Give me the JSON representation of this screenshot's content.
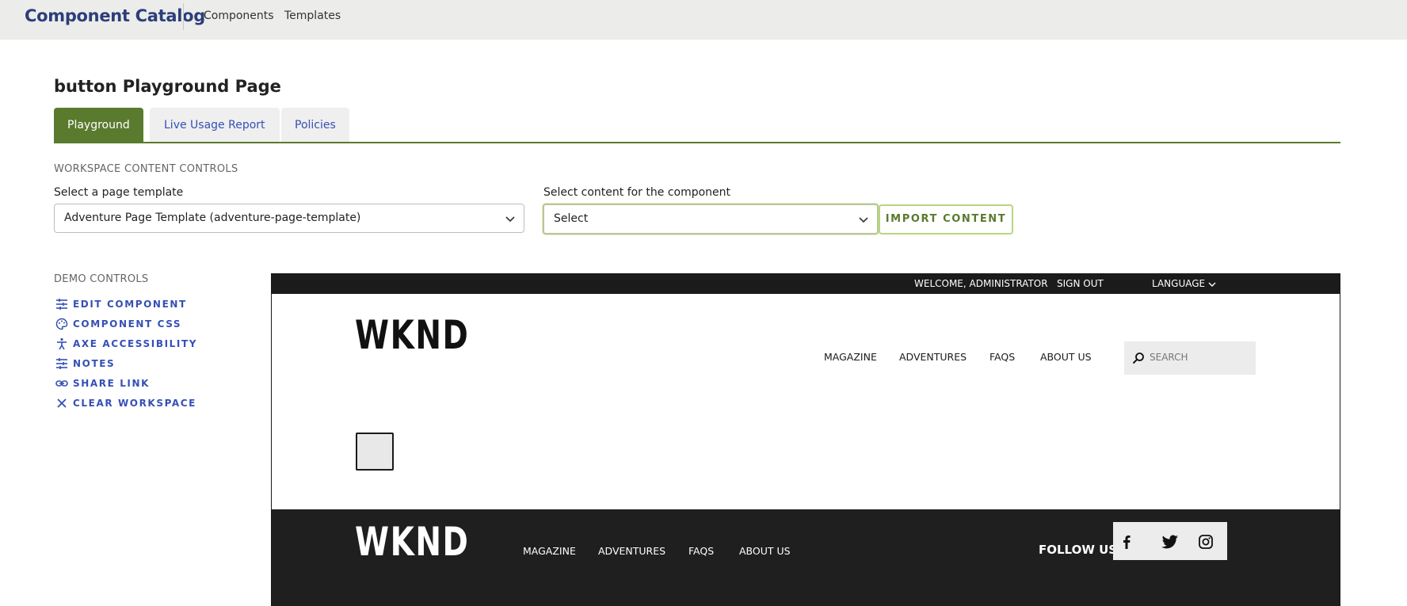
{
  "header": {
    "brand": "Component Catalog",
    "nav": [
      "Components",
      "Templates"
    ]
  },
  "page": {
    "title": "button Playground Page",
    "tabs": [
      {
        "label": "Playground",
        "active": true
      },
      {
        "label": "Live Usage Report",
        "active": false
      },
      {
        "label": "Policies",
        "active": false
      }
    ]
  },
  "workspace": {
    "section_label": "WORKSPACE CONTENT CONTROLS",
    "template_label": "Select a page template",
    "template_value": "Adventure Page Template (adventure-page-template)",
    "content_label": "Select content for the component",
    "content_value": "Select",
    "import_label": "IMPORT CONTENT"
  },
  "demo_controls": {
    "section_label": "DEMO CONTROLS",
    "items": [
      {
        "label": "EDIT COMPONENT",
        "icon": "sliders-icon"
      },
      {
        "label": "COMPONENT CSS",
        "icon": "palette-icon"
      },
      {
        "label": "AXE ACCESSIBILITY",
        "icon": "accessibility-icon"
      },
      {
        "label": "NOTES",
        "icon": "notes-icon"
      },
      {
        "label": "SHARE LINK",
        "icon": "link-icon"
      },
      {
        "label": "CLEAR WORKSPACE",
        "icon": "close-icon"
      }
    ]
  },
  "preview": {
    "topbar": {
      "welcome": "WELCOME, ADMINISTRATOR",
      "sign_out": "SIGN OUT",
      "language": "LANGUAGE"
    },
    "logo": "WKND",
    "nav": [
      "MAGAZINE",
      "ADVENTURES",
      "FAQS",
      "ABOUT US"
    ],
    "search_placeholder": "SEARCH",
    "footer": {
      "logo": "WKND",
      "nav": [
        "MAGAZINE",
        "ADVENTURES",
        "FAQS",
        "ABOUT US"
      ],
      "follow_label": "FOLLOW US",
      "social": [
        "facebook-icon",
        "twitter-icon",
        "instagram-icon"
      ]
    }
  },
  "colors": {
    "brand": "#2c3e7a",
    "accent_green": "#5a7a2e",
    "link_blue": "#3550b5",
    "preview_dark": "#1b1b1b"
  }
}
